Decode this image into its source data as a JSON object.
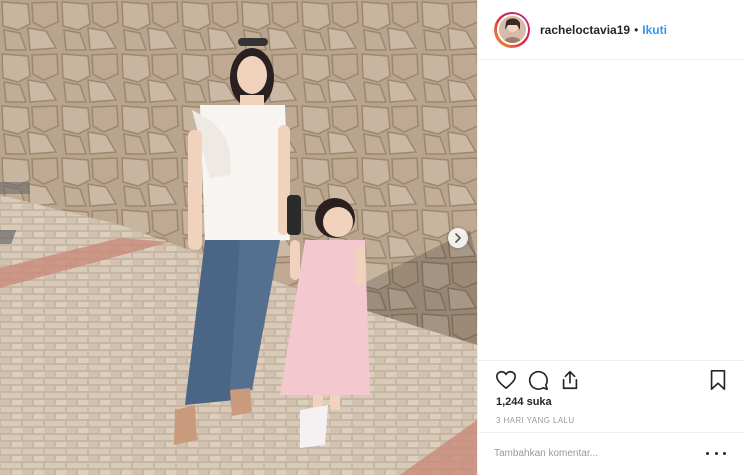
{
  "post": {
    "user": {
      "username": "racheloctavia19",
      "separator": "•",
      "follow_label": "Ikuti",
      "avatar_icon": "profile-photo"
    },
    "photo": {
      "icon": "photo",
      "next_icon": "chevron-right-icon"
    },
    "actions": {
      "like_icon": "heart-icon",
      "comment_icon": "comment-icon",
      "share_icon": "share-icon",
      "save_icon": "bookmark-icon"
    },
    "likes": "1,244 suka",
    "time_ago": "3 HARI YANG LALU",
    "comment": {
      "placeholder": "Tambahkan komentar...",
      "value": "",
      "more_icon": "more-options-icon"
    },
    "colors": {
      "link_blue": "#3897f0",
      "text": "#262626",
      "muted": "#999999",
      "border": "#efefef"
    }
  }
}
